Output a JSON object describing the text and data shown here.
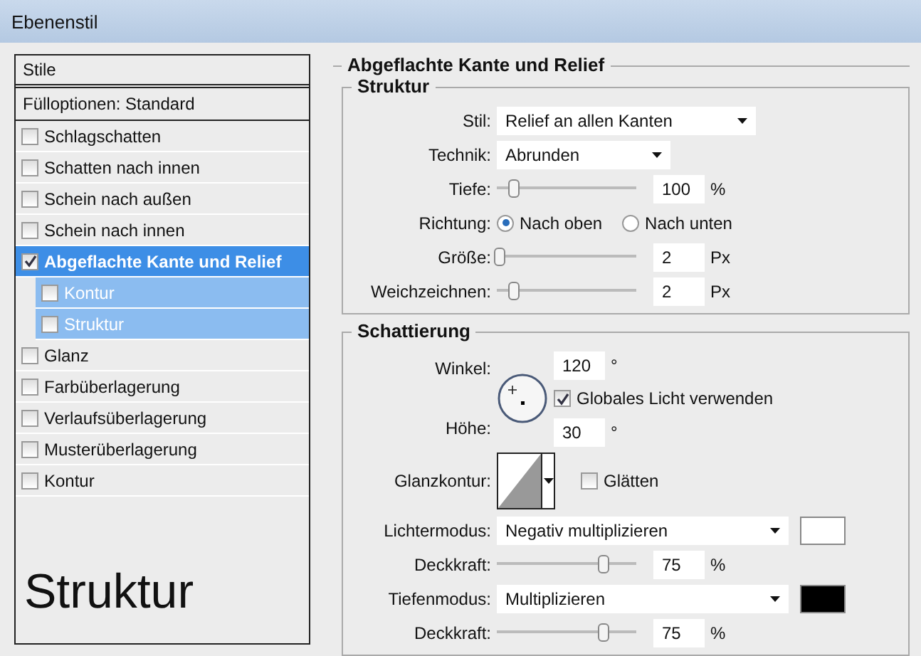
{
  "window": {
    "title": "Ebenenstil"
  },
  "styles_panel": {
    "header": "Stile",
    "blend_options": "Fülloptionen: Standard",
    "items": [
      {
        "label": "Schlagschatten",
        "checked": false,
        "selected": false
      },
      {
        "label": "Schatten nach innen",
        "checked": false,
        "selected": false
      },
      {
        "label": "Schein nach außen",
        "checked": false,
        "selected": false
      },
      {
        "label": "Schein nach innen",
        "checked": false,
        "selected": false
      },
      {
        "label": "Abgeflachte Kante und Relief",
        "checked": true,
        "selected": true,
        "children": [
          {
            "label": "Kontur",
            "checked": false
          },
          {
            "label": "Struktur",
            "checked": false
          }
        ]
      },
      {
        "label": "Glanz",
        "checked": false,
        "selected": false
      },
      {
        "label": "Farbüberlagerung",
        "checked": false,
        "selected": false
      },
      {
        "label": "Verlaufsüberlagerung",
        "checked": false,
        "selected": false
      },
      {
        "label": "Musterüberlagerung",
        "checked": false,
        "selected": false
      },
      {
        "label": "Kontur",
        "checked": false,
        "selected": false
      }
    ],
    "caption": "Struktur"
  },
  "section_title": "Abgeflachte Kante und Relief",
  "structure": {
    "title": "Struktur",
    "rows": [
      {
        "kind": "dropdown",
        "label": "Stil:",
        "value": "Relief an allen Kanten",
        "wide": true
      },
      {
        "kind": "dropdown",
        "label": "Technik:",
        "value": "Abrunden",
        "wide": false
      },
      {
        "kind": "slider",
        "label": "Tiefe:",
        "level": 0.12,
        "value": "100",
        "unit": "%"
      },
      {
        "kind": "radio",
        "label": "Richtung:",
        "options": [
          {
            "label": "Nach oben",
            "selected": true
          },
          {
            "label": "Nach unten",
            "selected": false
          }
        ]
      },
      {
        "kind": "slider",
        "label": "Größe:",
        "level": 0.02,
        "value": "2",
        "unit": "Px"
      },
      {
        "kind": "slider",
        "label": "Weichzeichnen:",
        "level": 0.12,
        "value": "2",
        "unit": "Px"
      }
    ]
  },
  "shading": {
    "title": "Schattierung",
    "angle_label": "Winkel:",
    "angle": "120",
    "angle_unit": "°",
    "global_light": {
      "label": "Globales Licht verwenden",
      "checked": true
    },
    "altitude_label": "Höhe:",
    "altitude": "30",
    "altitude_unit": "°",
    "gloss_label": "Glanzkontur:",
    "antialias": {
      "label": "Glätten",
      "checked": false
    },
    "rows": [
      {
        "kind": "mode",
        "label": "Lichtermodus:",
        "value": "Negativ multiplizieren",
        "color": "#ffffff"
      },
      {
        "kind": "slider",
        "label": "Deckkraft:",
        "level": 0.77,
        "value": "75",
        "unit": "%"
      },
      {
        "kind": "mode",
        "label": "Tiefenmodus:",
        "value": "Multiplizieren",
        "color": "#000000"
      },
      {
        "kind": "slider",
        "label": "Deckkraft:",
        "level": 0.77,
        "value": "75",
        "unit": "%"
      }
    ]
  }
}
